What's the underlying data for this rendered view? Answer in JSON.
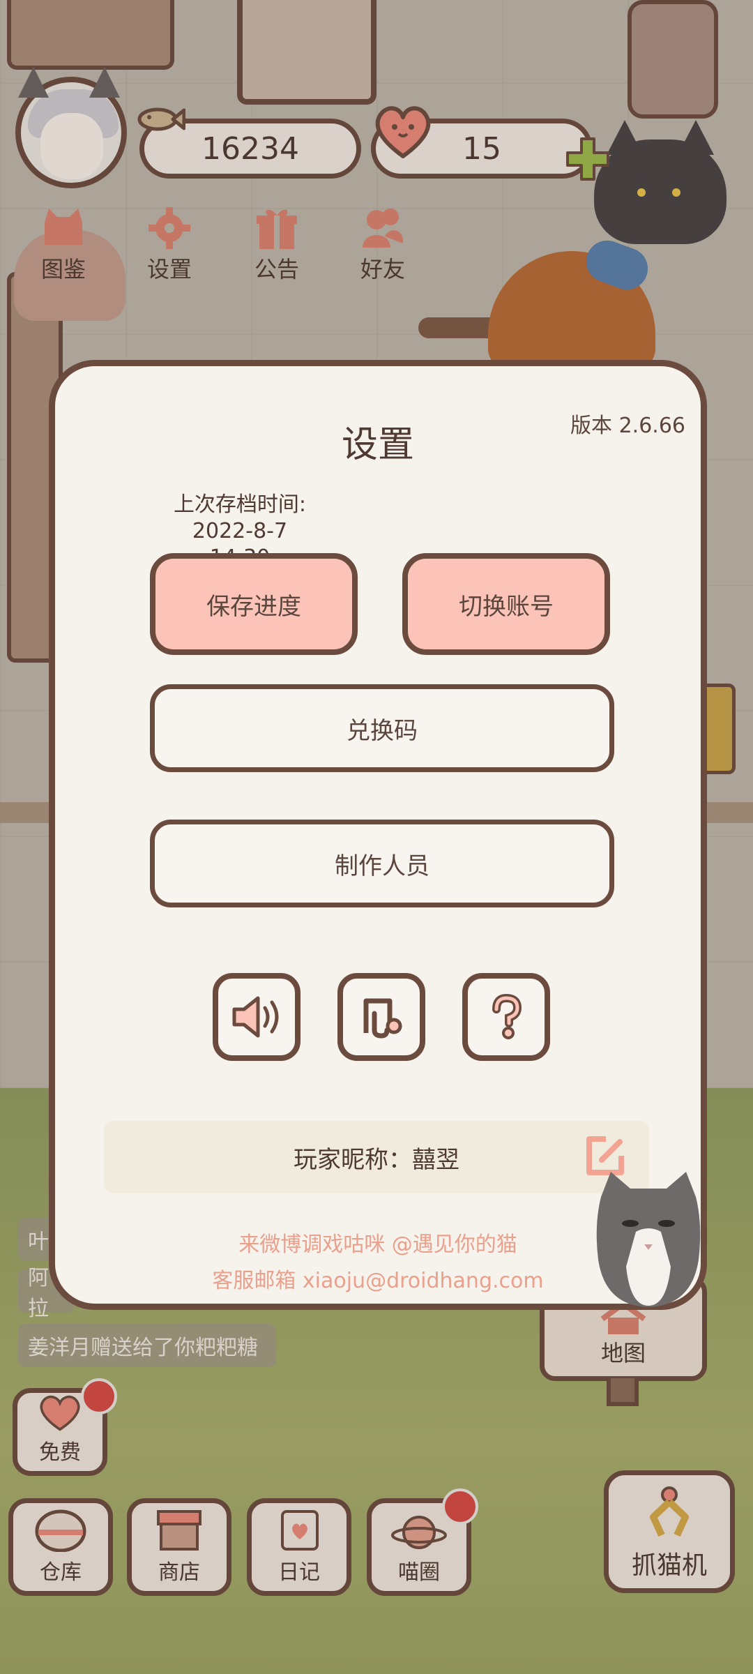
{
  "hud": {
    "fish_count": "16234",
    "heart_count": "15"
  },
  "top_menu": [
    {
      "label": "图鉴",
      "icon": "cat-book-icon"
    },
    {
      "label": "设置",
      "icon": "gear-icon"
    },
    {
      "label": "公告",
      "icon": "gift-icon"
    },
    {
      "label": "好友",
      "icon": "friends-icon"
    }
  ],
  "chat_log": [
    {
      "text": "叶"
    },
    {
      "text": "阿拉"
    },
    {
      "text": "姜洋月赠送给了你粑粑糖"
    }
  ],
  "settings_dialog": {
    "title": "设置",
    "version": "版本 2.6.66",
    "save_time_label": "上次存档时间:",
    "save_time_value": "2022-8-7 14:30",
    "save_button": "保存进度",
    "switch_account_button": "切换账号",
    "redeem_code_button": "兑换码",
    "credits_button": "制作人员",
    "icon_buttons": [
      "sound-icon",
      "music-icon",
      "help-icon"
    ],
    "nickname_label": "玩家昵称：",
    "nickname_value": "囍翌",
    "weibo_text": "来微博调戏咕咪 @遇见你的猫",
    "email_text": "客服邮箱 xiaoju@droidhang.com"
  },
  "map_button": {
    "label": "地图"
  },
  "bottom_nav": {
    "free": "免费",
    "warehouse": "仓库",
    "shop": "商店",
    "diary": "日记",
    "meow_circle": "喵圈",
    "claw_machine": "抓猫机"
  },
  "colors": {
    "outline": "#6b4b3e",
    "dialog_bg": "#f6f2ec",
    "pink_button": "#fcc4b8",
    "footer_text": "#e9a08d",
    "accent_icon": "#d9806c",
    "notification_dot": "#d44a44"
  }
}
